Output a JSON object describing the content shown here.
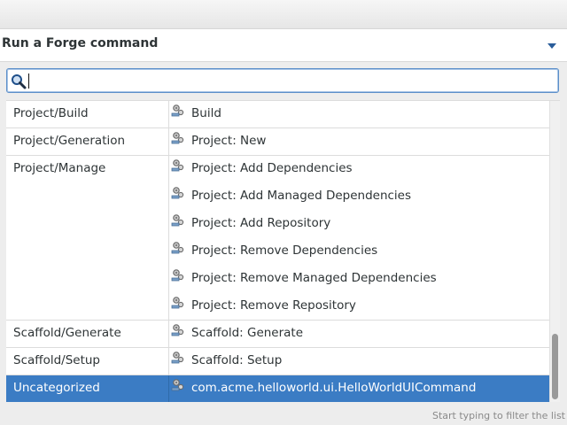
{
  "dialog": {
    "title": "Run a Forge command",
    "hint": "Start typing to filter the list"
  },
  "search": {
    "value": "",
    "placeholder": ""
  },
  "groups": [
    {
      "category": "Project/Build",
      "commands": [
        "Build"
      ]
    },
    {
      "category": "Project/Generation",
      "commands": [
        "Project: New"
      ]
    },
    {
      "category": "Project/Manage",
      "commands": [
        "Project: Add Dependencies",
        "Project: Add Managed Dependencies",
        "Project: Add Repository",
        "Project: Remove Dependencies",
        "Project: Remove Managed Dependencies",
        "Project: Remove Repository"
      ]
    },
    {
      "category": "Scaffold/Generate",
      "commands": [
        "Scaffold: Generate"
      ]
    },
    {
      "category": "Scaffold/Setup",
      "commands": [
        "Scaffold: Setup"
      ]
    },
    {
      "category": "Uncategorized",
      "commands": [
        "com.acme.helloworld.ui.HelloWorldUICommand"
      ],
      "selected": true
    }
  ],
  "icons": {
    "search": "search-icon",
    "command": "forge-command-icon",
    "menu": "dropdown-arrow-icon"
  },
  "colors": {
    "selection": "#3b7cc4",
    "focus_border": "#5c8fc9"
  }
}
